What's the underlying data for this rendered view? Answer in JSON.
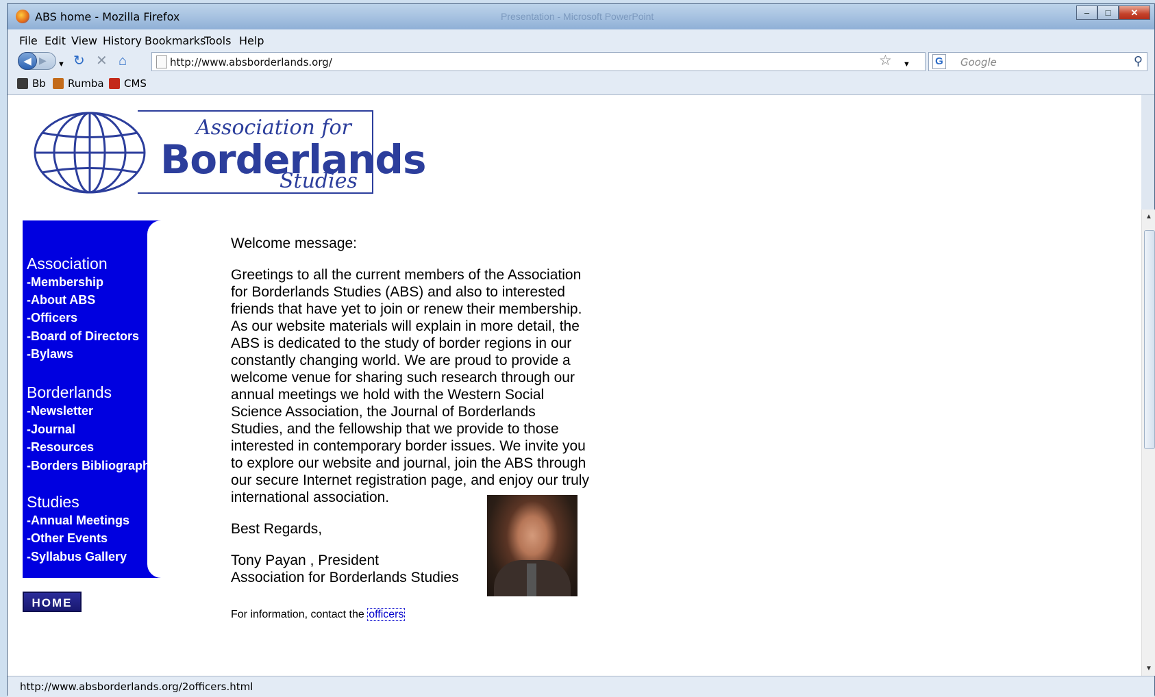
{
  "window": {
    "title": "ABS home - Mozilla Firefox",
    "background_app": "Presentation - Microsoft PowerPoint"
  },
  "menu": [
    "File",
    "Edit",
    "View",
    "History",
    "Bookmarks",
    "Tools",
    "Help"
  ],
  "nav": {
    "url": "http://www.absborderlands.org/",
    "search_placeholder": "Google"
  },
  "bookmarks": [
    {
      "label": "Bb",
      "color": "#3a3a3a"
    },
    {
      "label": "Rumba",
      "color": "#c36b1a"
    },
    {
      "label": "CMS",
      "color": "#c42a1a"
    }
  ],
  "logo": {
    "line1": "Association for",
    "line2": "Borderlands",
    "line3": "Studies",
    "color": "#2c3e9c"
  },
  "sidebar": {
    "color": "#0000e0",
    "sections": [
      {
        "heading": "Association",
        "links": [
          "-Membership",
          "-About ABS",
          "-Officers",
          "-Board of Directors",
          "-Bylaws"
        ]
      },
      {
        "heading": "Borderlands",
        "links": [
          "-Newsletter",
          "-Journal",
          "-Resources",
          "-Borders Bibliography"
        ]
      },
      {
        "heading": "Studies",
        "links": [
          "-Annual Meetings",
          "-Other Events",
          "-Syllabus Gallery"
        ]
      }
    ]
  },
  "home_button": "HOME",
  "main": {
    "heading": "Welcome message:",
    "lines": [
      "Greetings to all the current members of the Association",
      "for Borderlands Studies (ABS) and also to interested",
      "friends that have yet to join or renew their membership.",
      "As our website materials will explain in more detail, the",
      "ABS is dedicated to the study of border regions in our",
      "constantly changing world. We are proud to provide a",
      "welcome venue for sharing such research through our",
      "annual meetings we hold with the Western Social",
      "Science Association, the Journal of Borderlands",
      "Studies, and the fellowship that we provide to those",
      "interested in contemporary border issues. We invite you",
      "to explore our website and journal, join the ABS through",
      "our secure Internet registration page, and enjoy our truly",
      "international association."
    ],
    "regards": "Best Regards,",
    "signature_name": "Tony Payan , President",
    "signature_org": "Association for Borderlands Studies"
  },
  "footer": {
    "text": "For information, contact the ",
    "link": "officers"
  },
  "status": {
    "text": "http://www.absborderlands.org/2officers.html"
  }
}
